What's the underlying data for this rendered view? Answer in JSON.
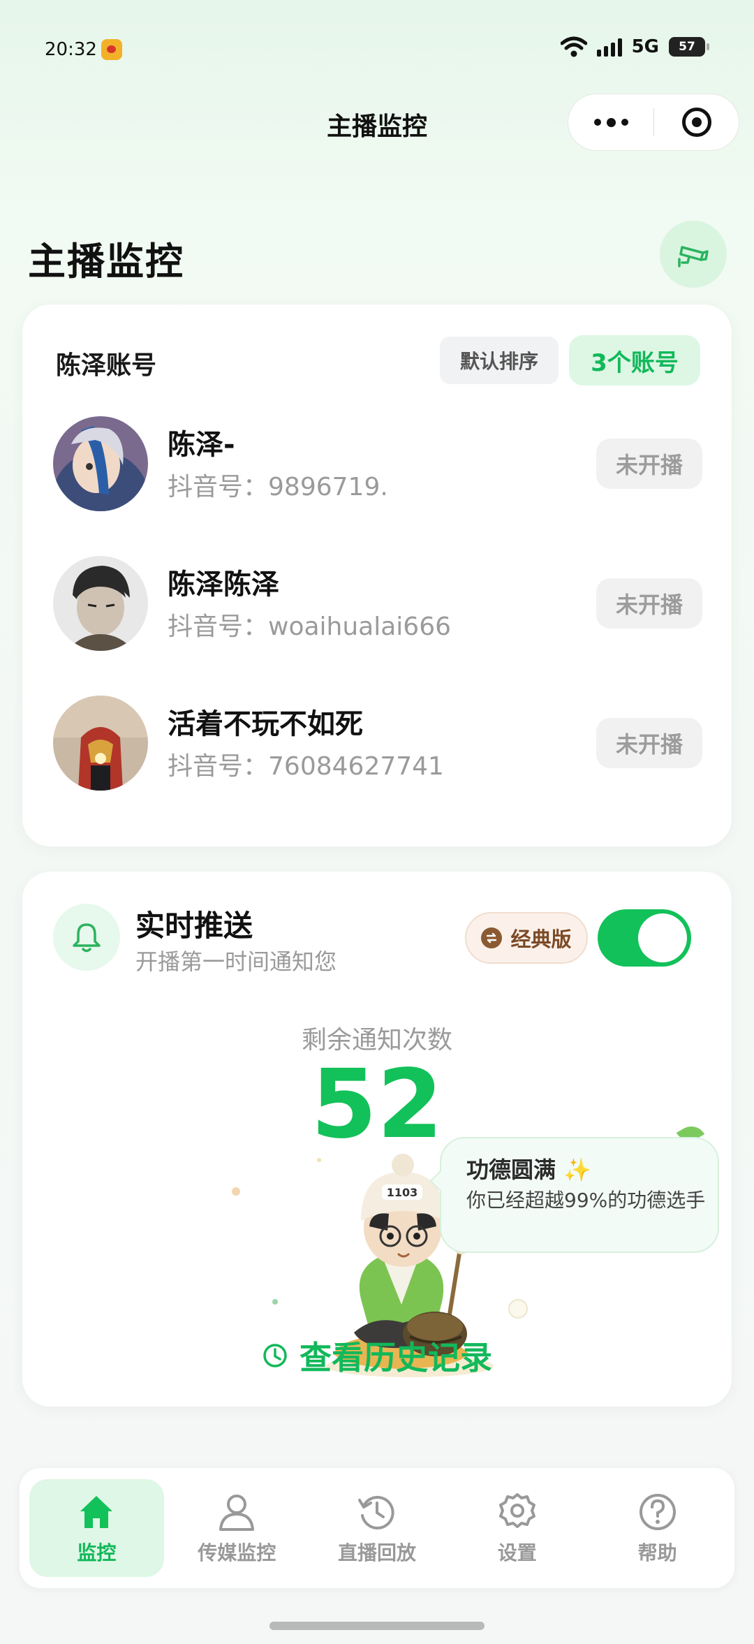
{
  "status_bar": {
    "time": "20:32",
    "network": "5G",
    "battery": "57"
  },
  "nav": {
    "title": "主播监控"
  },
  "page": {
    "title": "主播监控"
  },
  "accounts_card": {
    "title": "陈泽账号",
    "sort_label": "默认排序",
    "count_label": "3个账号",
    "accounts": [
      {
        "name": "陈泽-",
        "id_label": "抖音号：",
        "id": "9896719.",
        "status": "未开播"
      },
      {
        "name": "陈泽陈泽",
        "id_label": "抖音号：",
        "id": "woaihualai666",
        "status": "未开播"
      },
      {
        "name": "活着不玩不如死",
        "id_label": "抖音号：",
        "id": "76084627741",
        "status": "未开播"
      }
    ]
  },
  "push_card": {
    "title": "实时推送",
    "subtitle": "开播第一时间通知您",
    "edition": "经典版",
    "toggle_on": true,
    "remaining_label": "剩余通知次数",
    "remaining_count": "52",
    "bubble_title": "功德圆满 ✨",
    "bubble_text": "你已经超越99%的功德选手",
    "history_link": "查看历史记录"
  },
  "tabbar": {
    "items": [
      {
        "label": "监控",
        "icon": "home-icon",
        "active": true
      },
      {
        "label": "传媒监控",
        "icon": "person-icon",
        "active": false
      },
      {
        "label": "直播回放",
        "icon": "history-icon",
        "active": false
      },
      {
        "label": "设置",
        "icon": "gear-icon",
        "active": false
      },
      {
        "label": "帮助",
        "icon": "help-icon",
        "active": false
      }
    ]
  },
  "colors": {
    "accent": "#12c159",
    "accent_text": "#12b85a",
    "accent_bg": "#dff7e6"
  }
}
